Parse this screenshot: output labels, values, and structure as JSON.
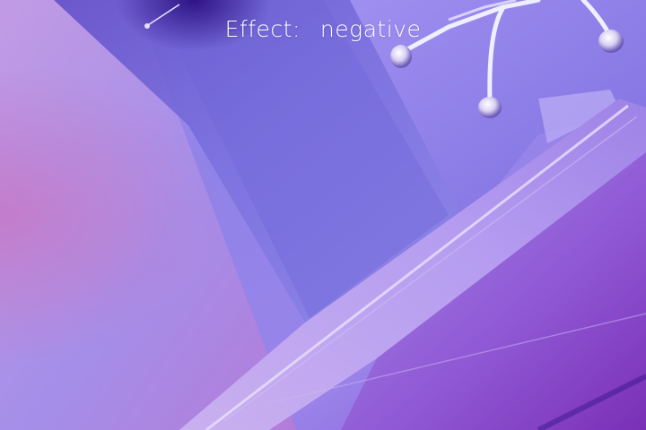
{
  "overlay": {
    "effect_label": "Effect:",
    "effect_value": "negative"
  },
  "colors": {
    "text": "#ffffff",
    "wall": "#8f82e6",
    "shadow_purple": "#5a2fb8",
    "highlight_lavender": "#d8cffb",
    "magenta_edge": "#b66bc2"
  },
  "icons": {
    "content": "camera-preview"
  }
}
